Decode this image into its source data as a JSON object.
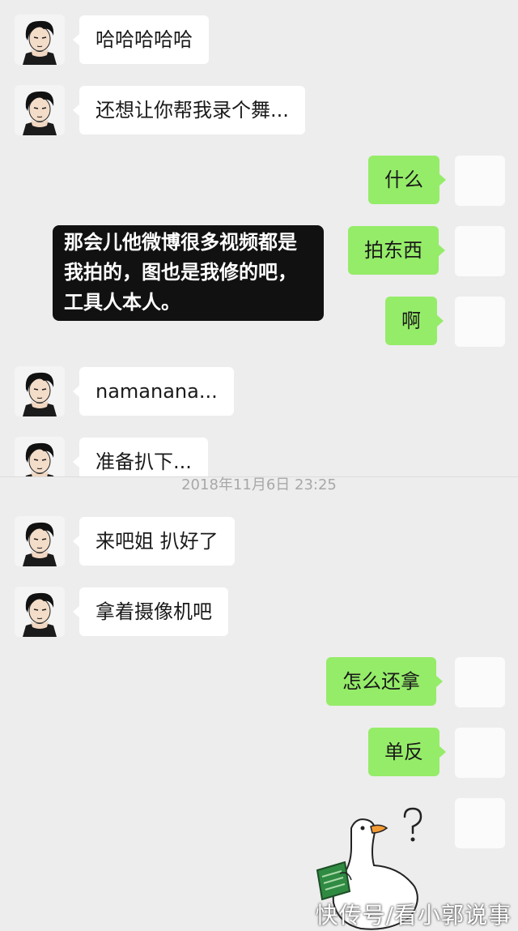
{
  "messages": [
    {
      "side": "in",
      "text": "哈哈哈哈哈"
    },
    {
      "side": "in",
      "text": "还想让你帮我录个舞..."
    },
    {
      "side": "out",
      "text": "什么"
    },
    {
      "side": "out",
      "text": "拍东西"
    },
    {
      "side": "out",
      "text": "啊"
    },
    {
      "side": "in",
      "text": "namanana..."
    },
    {
      "side": "in",
      "text": "准备扒下..."
    },
    {
      "side": "in",
      "text": "来吧姐 扒好了"
    },
    {
      "side": "in",
      "text": "拿着摄像机吧"
    },
    {
      "side": "out",
      "text": "怎么还拿"
    },
    {
      "side": "out",
      "text": "单反"
    }
  ],
  "caption": {
    "text": "那会儿他微博很多视频都是我拍的，图也是我修的吧，工具人本人。"
  },
  "timestamp": "2018年11月6日 23:25",
  "goose": {
    "mark": "?"
  },
  "watermark": "快传号/看小郭说事",
  "colors": {
    "background": "#ededed",
    "incoming_bubble": "#ffffff",
    "outgoing_bubble": "#95ec69"
  },
  "icons": {
    "contact_avatar": "man-avatar-icon",
    "self_avatar": "blank-avatar-icon",
    "sticker": "goose-reading-icon"
  }
}
